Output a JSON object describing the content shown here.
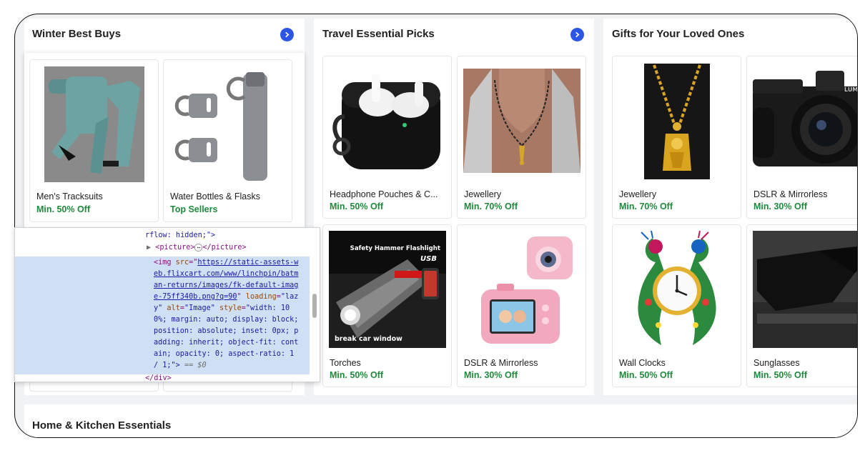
{
  "sections": {
    "winter": {
      "title": "Winter Best Buys",
      "items": [
        {
          "name": "Men's Tracksuits",
          "offer": "Min. 50% Off",
          "icon": "tracksuit-image"
        },
        {
          "name": "Water Bottles & Flasks",
          "offer": "Top Sellers",
          "icon": "flask-image"
        }
      ]
    },
    "travel": {
      "title": "Travel Essential Picks",
      "items": [
        {
          "name": "Headphone Pouches & C...",
          "offer": "Min. 50% Off",
          "icon": "earbuds-case-image"
        },
        {
          "name": "Jewellery",
          "offer": "Min. 70% Off",
          "icon": "necklace-image"
        },
        {
          "name": "Torches",
          "offer": "Min. 50% Off",
          "icon": "torch-image",
          "badge_top": "Safety Hammer Flashlight",
          "badge_usb": "USB",
          "badge_bottom": "break car window"
        },
        {
          "name": "DSLR & Mirrorless",
          "offer": "Min. 30% Off",
          "icon": "kids-camera-image"
        }
      ]
    },
    "gifts": {
      "title": "Gifts for Your Loved Ones",
      "items": [
        {
          "name": "Jewellery",
          "offer": "Min. 70% Off",
          "icon": "pendant-image"
        },
        {
          "name": "DSLR & Mirrorless",
          "offer": "Min. 30% Off",
          "icon": "dslr-camera-image",
          "brand": "LUMIX"
        },
        {
          "name": "Wall Clocks",
          "offer": "Min. 50% Off",
          "icon": "peacock-clock-image"
        },
        {
          "name": "Sunglasses",
          "offer": "Min. 50% Off",
          "icon": "sunglasses-image"
        }
      ]
    },
    "home": {
      "title": "Home & Kitchen Essentials"
    }
  },
  "devtools": {
    "line1": "rflow: hidden;\">",
    "line2_open": "<picture>",
    "line2_ellipsis": "⋯",
    "line2_close": "</picture>",
    "img_open": "<img ",
    "src_attr": "src",
    "src_eq": "=\"",
    "src_url_1": "https://static-assets-w",
    "src_url_2": "eb.flixcart.com/www/linchpin/batm",
    "src_url_3": "an-returns/images/fk-default-imag",
    "src_url_4": "e-75ff340b.png?q=90",
    "loading_attr": "loading",
    "loading_val_1": "\"laz",
    "loading_val_2": "y\"",
    "alt_attr": "alt",
    "alt_val": "\"Image\"",
    "style_attr": "style",
    "style_val_1": "\"width: 10",
    "style_val_2": "0%; margin: auto; display: block;",
    "style_val_3": "position: absolute; inset: 0px; p",
    "style_val_4": "adding: inherit; object-fit: cont",
    "style_val_5": "ain; opacity: 0; aspect-ratio: 1",
    "style_val_6": "/ 1;\">",
    "eq_dollar": "== $0",
    "last_line": "</div>"
  },
  "colors": {
    "accent": "#2a55e5",
    "offer_green": "#1f8a3b",
    "selection": "#cfe0f5"
  }
}
